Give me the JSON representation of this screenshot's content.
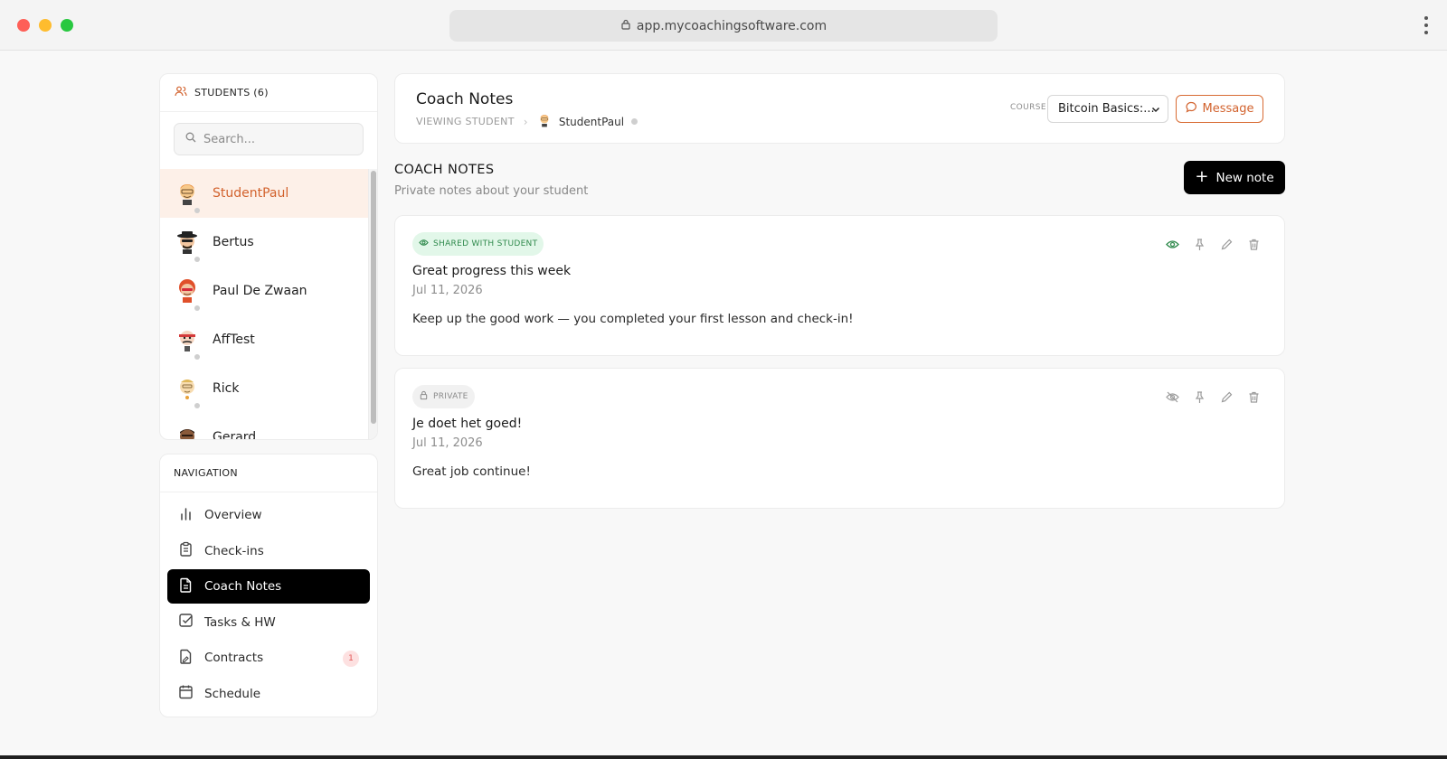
{
  "browser": {
    "url": "app.mycoachingsoftware.com"
  },
  "students_panel": {
    "title": "STUDENTS (6)",
    "search_placeholder": "Search...",
    "students": [
      {
        "name": "StudentPaul",
        "active": true
      },
      {
        "name": "Bertus",
        "active": false
      },
      {
        "name": "Paul De Zwaan",
        "active": false
      },
      {
        "name": "AffTest",
        "active": false
      },
      {
        "name": "Rick",
        "active": false
      },
      {
        "name": "Gerard",
        "active": false
      }
    ]
  },
  "navigation": {
    "title": "NAVIGATION",
    "items": [
      {
        "label": "Overview",
        "icon": "bar-chart-icon"
      },
      {
        "label": "Check-ins",
        "icon": "clipboard-icon"
      },
      {
        "label": "Coach Notes",
        "icon": "document-icon",
        "active": true
      },
      {
        "label": "Tasks & HW",
        "icon": "checkbox-icon"
      },
      {
        "label": "Contracts",
        "icon": "contract-icon",
        "badge": "1"
      },
      {
        "label": "Schedule",
        "icon": "calendar-icon"
      }
    ]
  },
  "header": {
    "title": "Coach Notes",
    "breadcrumb_label": "VIEWING STUDENT",
    "student_name": "StudentPaul",
    "course_label": "COURSE",
    "course_value": "Bitcoin Basics:...",
    "message_button": "Message"
  },
  "notes_section": {
    "title": "COACH NOTES",
    "subtitle": "Private notes about your student",
    "new_note_button": "New note",
    "notes": [
      {
        "visibility": "SHARED WITH STUDENT",
        "title": "Great progress this week",
        "date": "Jul 11, 2026",
        "body": "Keep up the good work — you completed your first lesson and check-in!"
      },
      {
        "visibility": "PRIVATE",
        "title": "Je doet het goed!",
        "date": "Jul 11, 2026",
        "body": "Great job continue!"
      }
    ]
  },
  "colors": {
    "accent": "#d2622d",
    "active_row_bg": "#fdf0e8",
    "shared_green": "#2f8a4c",
    "badge_red": "#e25555"
  }
}
